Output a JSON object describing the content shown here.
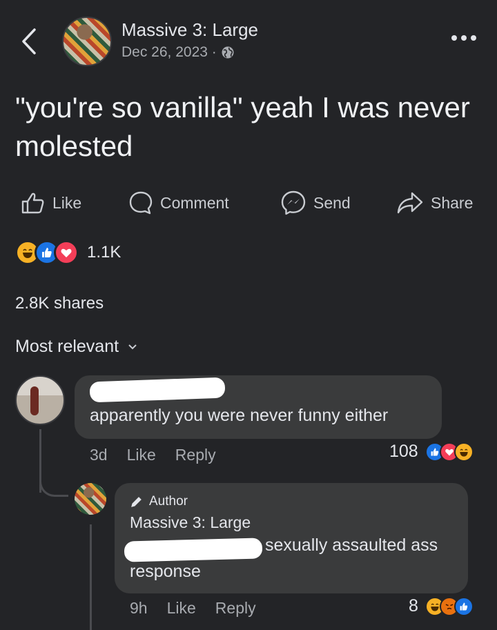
{
  "post": {
    "author": "Massive 3: Large",
    "date": "Dec 26, 2023 ·",
    "text": "\"you're so vanilla\" yeah I was never molested",
    "actions": {
      "like": "Like",
      "comment": "Comment",
      "send": "Send",
      "share": "Share"
    },
    "reaction_count": "1.1K",
    "shares": "2.8K shares",
    "sort_label": "Most relevant"
  },
  "comments": [
    {
      "text": "apparently you were never funny either",
      "age": "3d",
      "like": "Like",
      "reply": "Reply",
      "reaction_count": "108"
    },
    {
      "badge": "Author",
      "author": "Massive 3: Large",
      "text_line1": "sexually assaulted ass",
      "text_line2": "response",
      "age": "9h",
      "like": "Like",
      "reply": "Reply",
      "reaction_count": "8"
    }
  ],
  "colors": {
    "background": "#232427",
    "bubble": "#3a3b3c",
    "like_blue": "#1b74e4",
    "love_red": "#f33e58",
    "haha_yellow": "#f7b125",
    "angry_orange": "#e9710f"
  },
  "icons": [
    "back-chevron-icon",
    "globe-icon",
    "more-icon",
    "like-thumb-icon",
    "comment-bubble-icon",
    "messenger-icon",
    "share-arrow-icon",
    "chevron-down-icon",
    "pencil-icon"
  ]
}
